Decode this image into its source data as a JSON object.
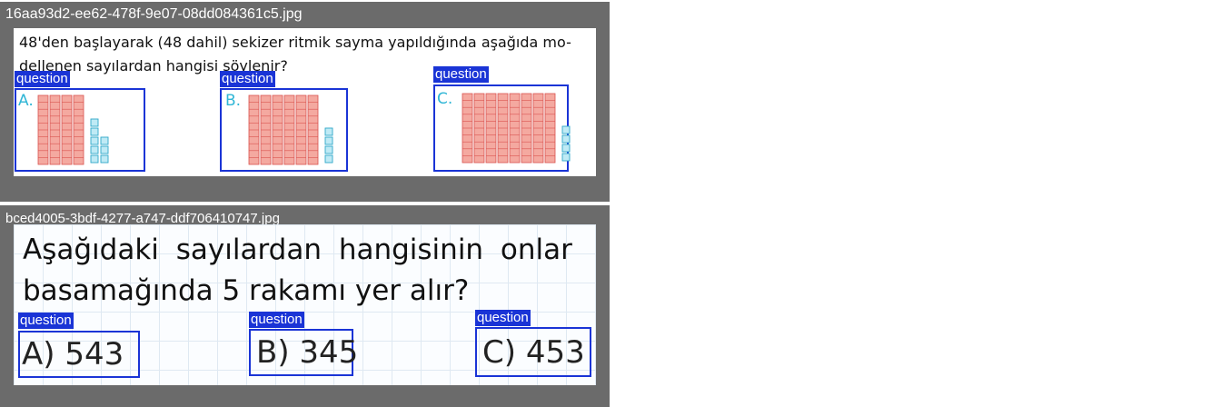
{
  "panel1": {
    "filename": "16aa93d2-ee62-478f-9e07-08dd084361c5.jpg",
    "question_line1": "48'den başlayarak (48 dahil) sekizer ritmik sayma yapıldığında aşağıda mo-",
    "question_line2": "dellenen sayılardan hangisi söylenir?",
    "options": [
      {
        "tag": "question",
        "letter": "A.",
        "tens": 4,
        "ones": 8
      },
      {
        "tag": "question",
        "letter": "B.",
        "tens": 6,
        "ones": 4
      },
      {
        "tag": "question",
        "letter": "C.",
        "tens": 8,
        "ones": 4
      }
    ],
    "colors": {
      "tens_fill": "#f4a9a0",
      "tens_stroke": "#d9534f",
      "ones_fill": "#bfeaf5",
      "ones_stroke": "#2fa7c9",
      "box": "#1a34d6"
    }
  },
  "panel2": {
    "filename": "bced4005-3bdf-4277-a747-ddf706410747.jpg",
    "question_line1": "Aşağıdaki sayılardan hangisinin onlar",
    "question_line2": "basamağında 5 rakamı yer alır?",
    "options": [
      {
        "tag": "question",
        "answer": "A) 543"
      },
      {
        "tag": "question",
        "answer": "B) 345"
      },
      {
        "tag": "question",
        "answer": "C) 453"
      }
    ]
  }
}
